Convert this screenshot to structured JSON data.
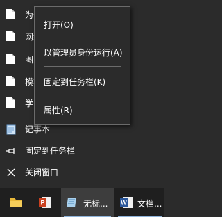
{
  "jumplist": {
    "recent": [
      {
        "label": "为什么",
        "icon": "document-icon"
      },
      {
        "label": "网络",
        "icon": "document-icon"
      },
      {
        "label": "图片",
        "icon": "document-icon"
      },
      {
        "label": "模板",
        "icon": "document-icon"
      },
      {
        "label": "学习",
        "icon": "document-icon"
      }
    ],
    "tasks": {
      "app_label": "记事本",
      "pin_label": "固定到任务栏",
      "close_label": "关闭窗口"
    }
  },
  "context_menu": {
    "open": "打开(O)",
    "run_as_admin": "以管理员身份运行(A)",
    "pin_taskbar": "固定到任务栏(K)",
    "properties": "属性(R)"
  },
  "taskbar": {
    "notepad_label": "无标...",
    "word_label": "文档..."
  },
  "colors": {
    "panel": "#2b2b2b",
    "taskbar": "#1f1f1f",
    "accent_underline": "#8fb3d9",
    "menu_border": "#6b6b6b"
  }
}
